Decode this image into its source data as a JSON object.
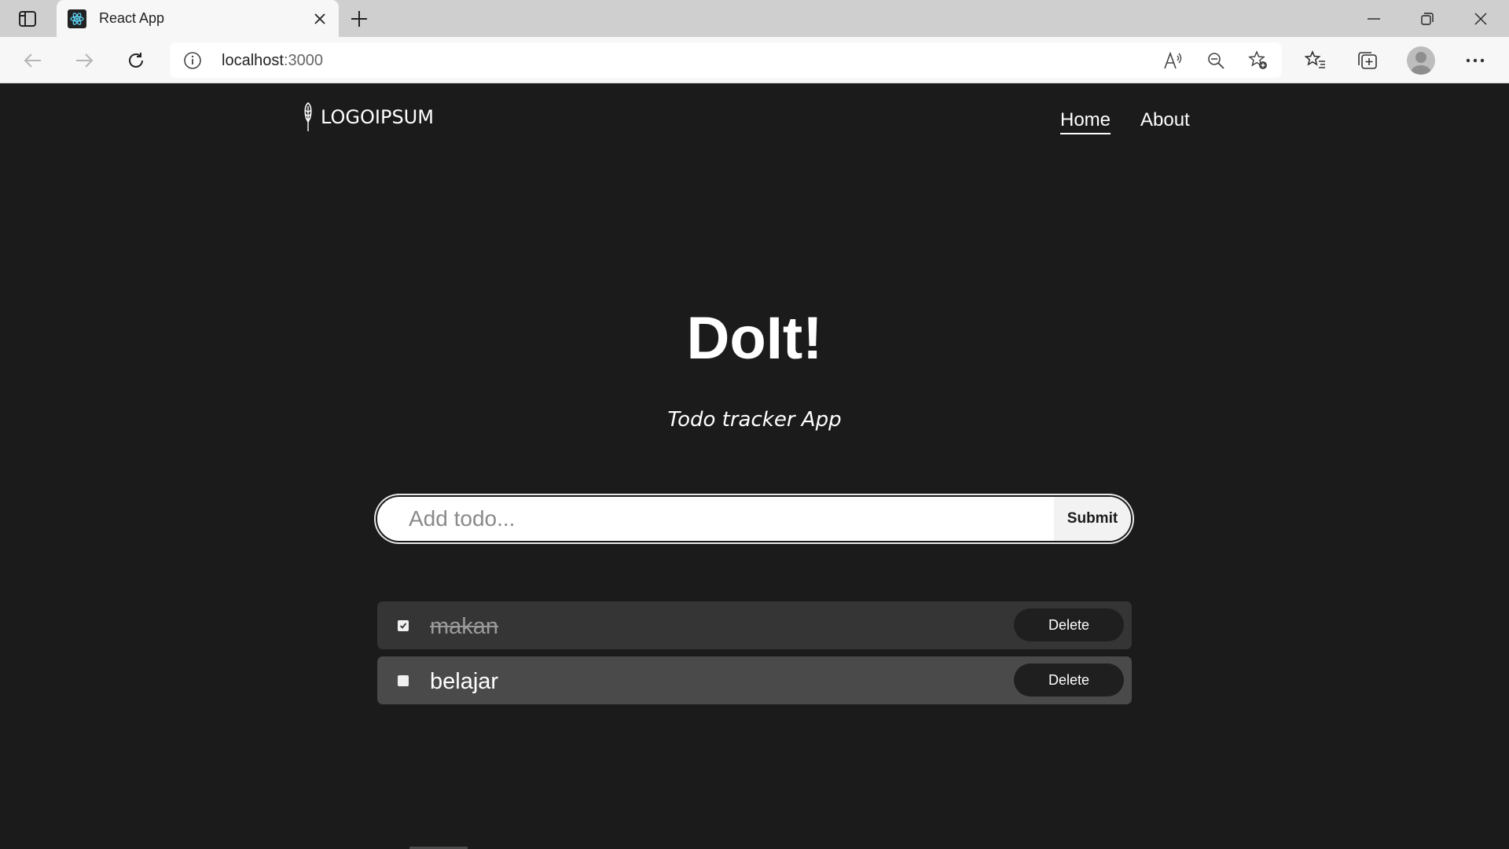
{
  "browser": {
    "tab_title": "React App",
    "url_host": "localhost",
    "url_port": ":3000"
  },
  "header": {
    "logo_text": "LOGOIPSUM",
    "nav": [
      {
        "label": "Home",
        "active": true
      },
      {
        "label": "About",
        "active": false
      }
    ]
  },
  "hero": {
    "title": "DoIt!",
    "subtitle": "Todo tracker App"
  },
  "form": {
    "placeholder": "Add todo...",
    "submit_label": "Submit"
  },
  "todos": [
    {
      "text": "makan",
      "done": true,
      "delete_label": "Delete"
    },
    {
      "text": "belajar",
      "done": false,
      "delete_label": "Delete"
    }
  ],
  "colors": {
    "page_bg": "#1b1b1b",
    "done_item_bg": "#353535",
    "open_item_bg": "#4a4a4a"
  }
}
